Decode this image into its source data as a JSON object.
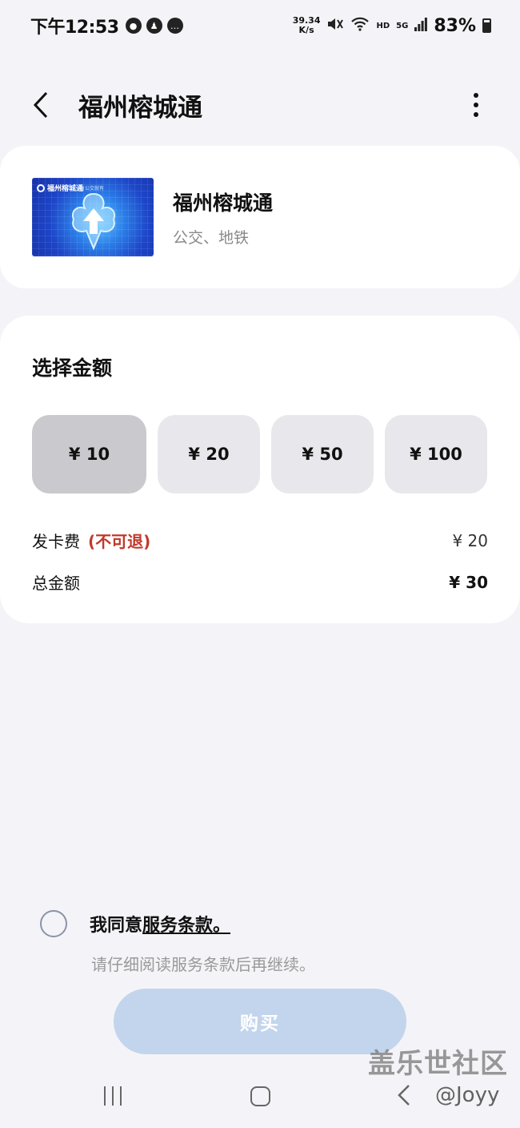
{
  "status_bar": {
    "time": "下午12:53",
    "net_speed_value": "39.34",
    "net_speed_unit": "K/s",
    "hd": "HD",
    "network": "5G",
    "battery": "83%"
  },
  "header": {
    "title": "福州榕城通"
  },
  "card": {
    "name": "福州榕城通",
    "description": "公交、地铁",
    "image_brand": "福州榕城通",
    "image_tag": "有公交就有"
  },
  "amount_section": {
    "title": "选择金额",
    "options": [
      {
        "label": "¥ 10",
        "selected": true
      },
      {
        "label": "¥ 20",
        "selected": false
      },
      {
        "label": "¥ 50",
        "selected": false
      },
      {
        "label": "¥ 100",
        "selected": false
      }
    ],
    "fee_label": "发卡费",
    "fee_note": "(不可退)",
    "fee_value": "¥ 20",
    "total_label": "总金额",
    "total_value": "¥ 30"
  },
  "agreement": {
    "prefix": "我同意",
    "terms_link": "服务条款。",
    "hint": "请仔细阅读服务条款后再继续。",
    "checked": false
  },
  "buy_button": {
    "label": "购买",
    "enabled": false
  },
  "watermark": {
    "community": "盖乐世社区",
    "user": "@Joyy"
  },
  "colors": {
    "background": "#f4f4f8",
    "panel": "#ffffff",
    "selected_amount": "#c9c9ce",
    "amount_option": "#e8e8ec",
    "fee_note": "#c0392b",
    "buy_button_disabled": "#c2d5ec"
  }
}
